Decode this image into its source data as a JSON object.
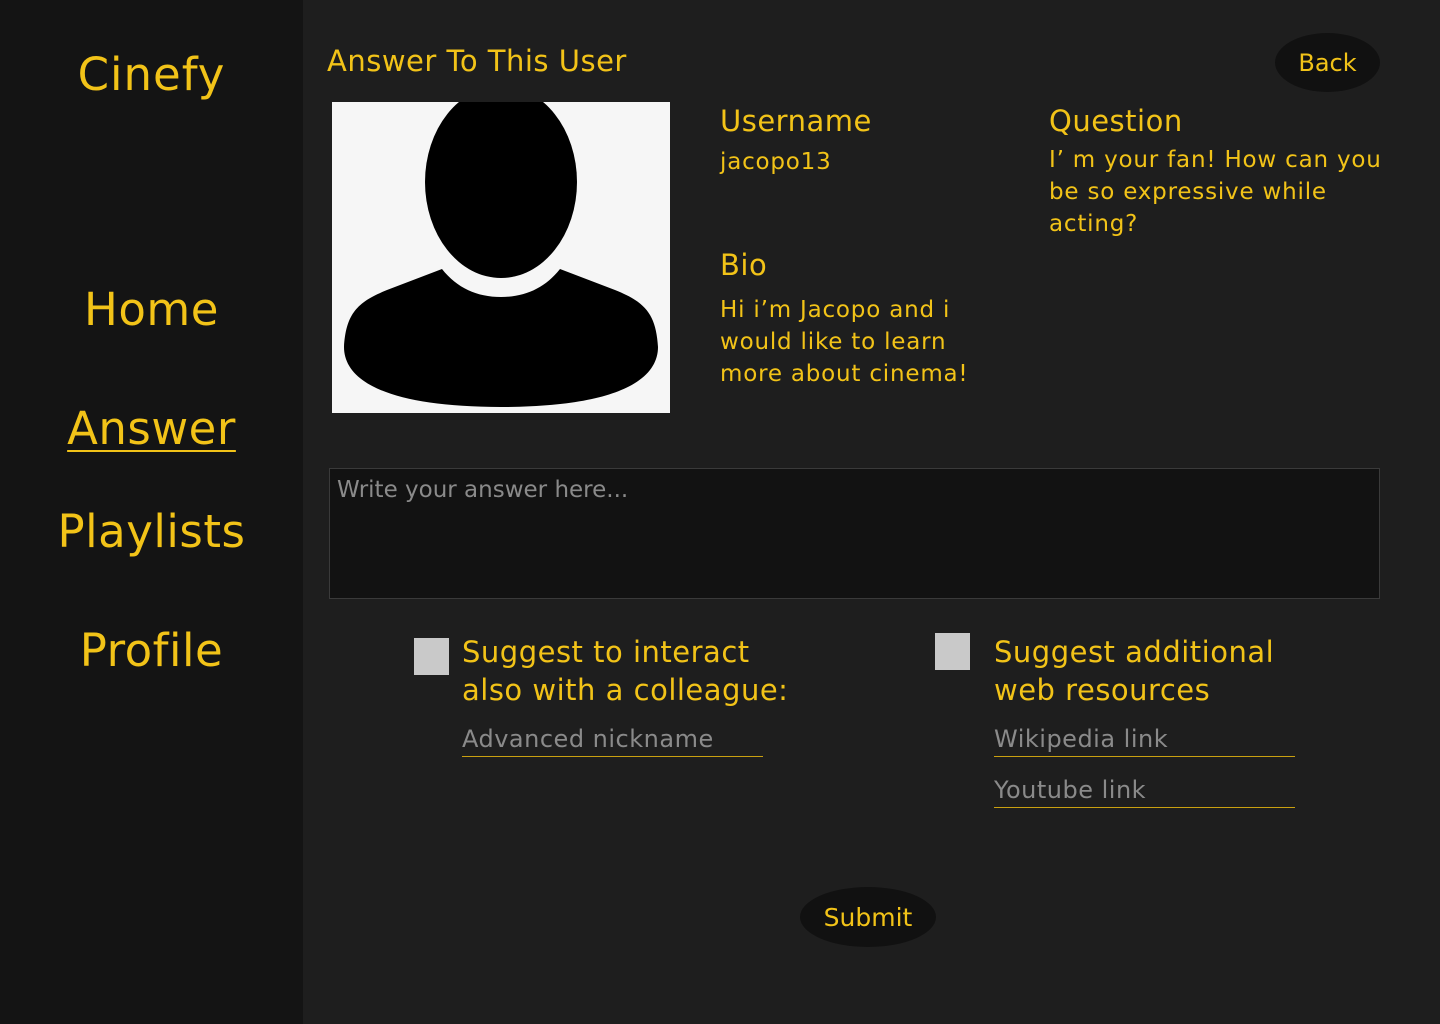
{
  "sidebar": {
    "brand": "Cinefy",
    "items": [
      {
        "label": "Home"
      },
      {
        "label": "Answer"
      },
      {
        "label": "Playlists"
      },
      {
        "label": "Profile"
      }
    ]
  },
  "header": {
    "title": "Answer To This User",
    "back_label": "Back"
  },
  "user": {
    "avatar_icon": "user-silhouette-icon",
    "username_label": "Username",
    "username": "jacopo13",
    "bio_label": "Bio",
    "bio": "Hi i’m Jacopo and i would like to learn more about cinema!",
    "question_label": "Question",
    "question": "I’ m your fan! How can you be so expressive while acting?"
  },
  "answer": {
    "placeholder": "Write your answer here..."
  },
  "options": {
    "colleague": {
      "label": "Suggest to interact also with a colleague:",
      "nickname_placeholder": "Advanced nickname"
    },
    "resources": {
      "label": "Suggest additional web resources",
      "wikipedia_placeholder": "Wikipedia link",
      "youtube_placeholder": "Youtube link"
    }
  },
  "submit_label": "Submit",
  "colors": {
    "accent": "#f2c318",
    "sidebar_bg": "#141414",
    "main_bg": "#1e1e1e"
  }
}
